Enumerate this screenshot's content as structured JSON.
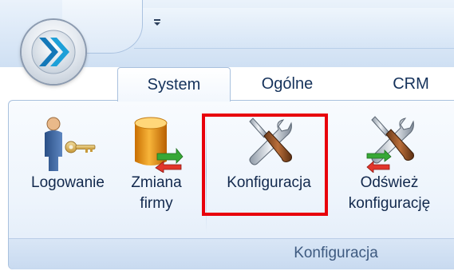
{
  "tabs": [
    {
      "label": "System",
      "active": true
    },
    {
      "label": "Ogólne",
      "active": false
    },
    {
      "label": "CRM",
      "active": false
    }
  ],
  "ribbon": {
    "buttons": {
      "logowanie": {
        "label_lines": [
          "Logowanie"
        ],
        "icon": "user-key-icon"
      },
      "zmiana_firmy": {
        "label_lines": [
          "Zmiana",
          "firmy"
        ],
        "icon": "database-switch-icon"
      },
      "konfiguracja": {
        "label_lines": [
          "Konfiguracja"
        ],
        "icon": "tools-icon",
        "highlighted": true
      },
      "odswiez": {
        "label_lines": [
          "Odśwież",
          "konfigurację"
        ],
        "icon": "tools-refresh-icon"
      }
    },
    "group_caption": "Konfiguracja"
  },
  "colors": {
    "highlight": "#e8000b",
    "tab_text": "#15325b",
    "ribbon_border": "#a9c1de"
  },
  "icons": {
    "app_orb": "app-orb-chevrons-icon",
    "qat_dropdown": "customize-quick-access-icon"
  }
}
